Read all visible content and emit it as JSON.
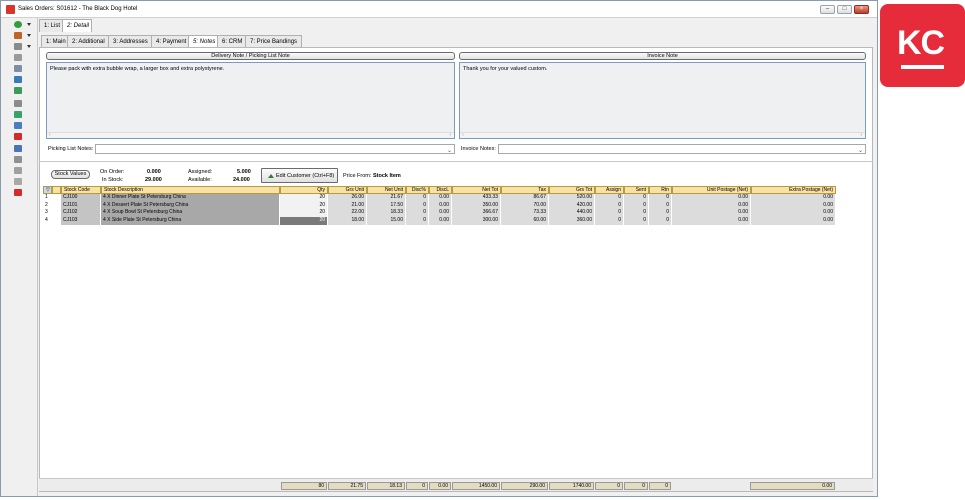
{
  "window": {
    "title": "Sales Orders: S01612 - The Black Dog Hotel",
    "controls": [
      "–",
      "□",
      "×"
    ]
  },
  "toolbar_icons": [
    "add-icon",
    "edit-icon",
    "copy-icon",
    "filter-icon",
    "back-icon",
    "import-icon",
    "export-icon",
    "print-icon",
    "attach-icon",
    "process-icon",
    "delete-icon",
    "save-icon",
    "list-icon",
    "report-icon",
    "report2-icon",
    "close-icon"
  ],
  "tabs_top": [
    {
      "label": "1: List"
    },
    {
      "label": "2: Detail"
    }
  ],
  "tabs_sub": [
    {
      "label": "1: Main"
    },
    {
      "label": "2: Additional"
    },
    {
      "label": "3: Addresses"
    },
    {
      "label": "4: Payment"
    },
    {
      "label": "5: Notes"
    },
    {
      "label": "6: CRM"
    },
    {
      "label": "7: Price Bandings"
    }
  ],
  "notes": {
    "delivery_header": "Delivery Note / Picking List Note",
    "delivery_text": "Please pack with extra bubble wrap, a larger box and extra polystyrene.",
    "invoice_header": "Invoice Note",
    "invoice_text": "Thank you for your valued custom.",
    "picking_label": "Picking List Notes:",
    "invoice_label": "Invoice Notes:"
  },
  "stock": {
    "button": "Stock Values",
    "on_order_label": "On Order:",
    "on_order": "0.000",
    "in_stock_label": "In Stock:",
    "in_stock": "29.000",
    "assigned_label": "Assigned:",
    "assigned": "5.000",
    "available_label": "Available:",
    "available": "24.000",
    "edit_customer": "Edit Customer (Ctrl+F8)",
    "price_from_label": "Price From:",
    "price_from": "Stock Item"
  },
  "grid": {
    "columns": [
      "",
      "",
      "Stock Code",
      "Stock Description",
      "Qty",
      "Grs Unit",
      "Net Unit",
      "Disc%",
      "DiscL",
      "Net Tot",
      "Tax",
      "Grs Tot",
      "Assign",
      "Sent",
      "Rtn",
      "Unit Postage (Net)",
      "Extra Postage (Net)"
    ],
    "rows": [
      [
        "1",
        "",
        "CJ100",
        "4 X Dinner Plate St Petersburg China",
        "20",
        "26.00",
        "21.67",
        "0",
        "0.00",
        "433.33",
        "86.67",
        "520.00",
        "0",
        "0",
        "0",
        "0.00",
        "0.00"
      ],
      [
        "2",
        "",
        "CJ101",
        "4 X Dessert Plate St Petersburg China",
        "20",
        "21.00",
        "17.50",
        "0",
        "0.00",
        "350.00",
        "70.00",
        "420.00",
        "0",
        "0",
        "0",
        "0.00",
        "0.00"
      ],
      [
        "3",
        "",
        "CJ102",
        "4 X Soup Bowl St Petersburg China",
        "20",
        "22.00",
        "18.33",
        "0",
        "0.00",
        "366.67",
        "73.33",
        "440.00",
        "0",
        "0",
        "0",
        "0.00",
        "0.00"
      ],
      [
        "4",
        "",
        "CJ103",
        "4 X Side Plate St Petersburg China",
        "20",
        "18.00",
        "15.00",
        "0",
        "0.00",
        "300.00",
        "60.00",
        "360.00",
        "0",
        "0",
        "0",
        "0.00",
        "0.00"
      ]
    ],
    "totals": {
      "qty": "80",
      "grs_unit": "21.75",
      "net_unit": "18.13",
      "disc": "0",
      "discl": "0.00",
      "net_tot": "1450.00",
      "tax": "290.00",
      "grs_tot": "1740.00",
      "assign": "0",
      "sent": "0",
      "rtn": "0",
      "extra": "0.00"
    }
  },
  "badge": {
    "text": "KC",
    "color": "#e62b3b"
  }
}
